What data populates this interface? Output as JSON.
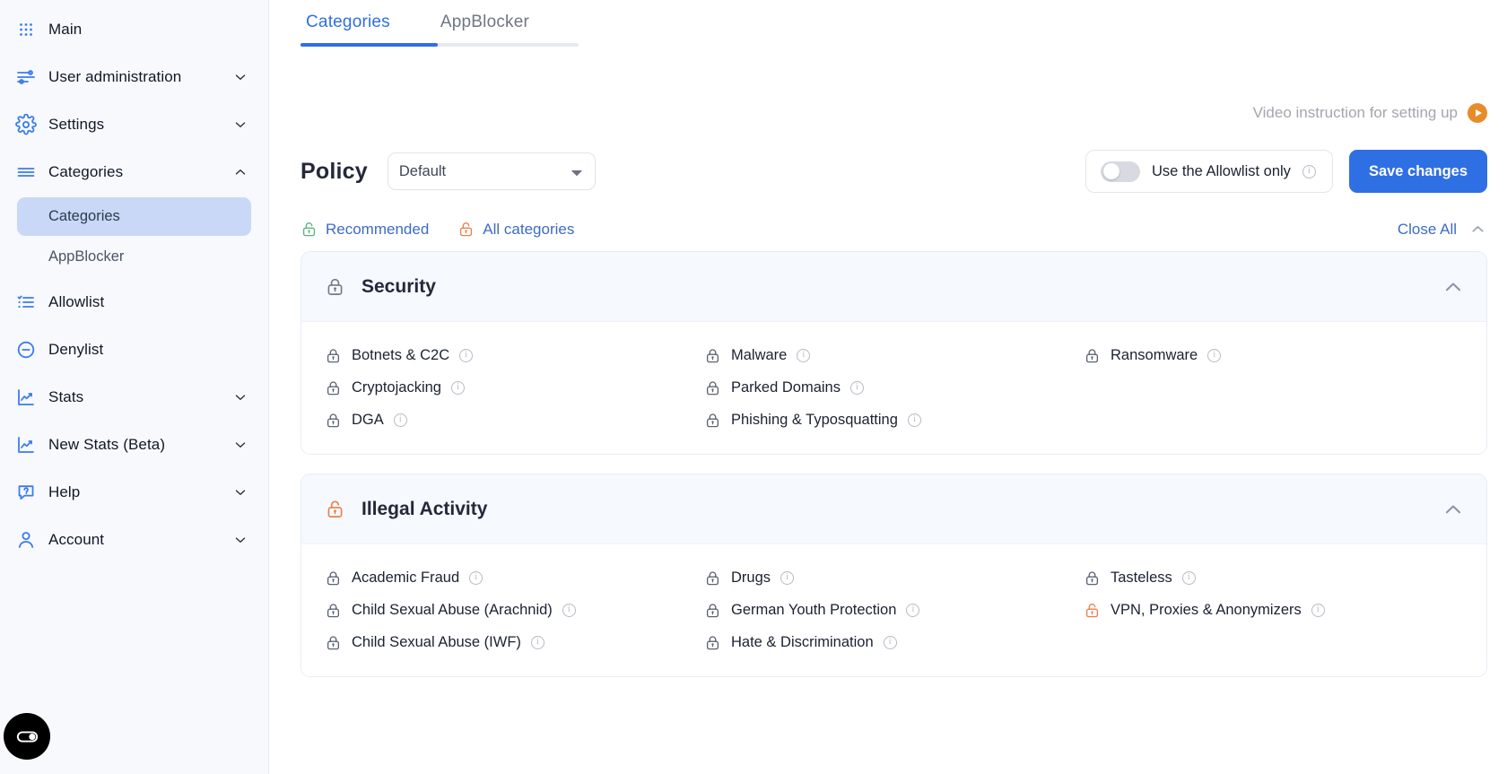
{
  "sidebar": {
    "items": [
      {
        "label": "Main",
        "icon": "grid-icon",
        "chevron": null
      },
      {
        "label": "User administration",
        "icon": "sliders-icon",
        "chevron": "down"
      },
      {
        "label": "Settings",
        "icon": "gear-icon",
        "chevron": "down"
      },
      {
        "label": "Categories",
        "icon": "menu-icon",
        "chevron": "up"
      }
    ],
    "sub_items": [
      {
        "label": "Categories",
        "active": true
      },
      {
        "label": "AppBlocker",
        "active": false
      }
    ],
    "items_bottom": [
      {
        "label": "Allowlist",
        "icon": "list-check-icon",
        "chevron": null
      },
      {
        "label": "Denylist",
        "icon": "minus-circle-icon",
        "chevron": null
      },
      {
        "label": "Stats",
        "icon": "chart-line-icon",
        "chevron": "down"
      },
      {
        "label": "New Stats (Beta)",
        "icon": "chart-line-icon",
        "chevron": "down"
      },
      {
        "label": "Help",
        "icon": "help-chat-icon",
        "chevron": "down"
      },
      {
        "label": "Account",
        "icon": "user-icon",
        "chevron": "down"
      }
    ],
    "cookie_button_icon": "cookie-consent-icon"
  },
  "tabs": [
    {
      "label": "Categories",
      "active": true
    },
    {
      "label": "AppBlocker",
      "active": false
    }
  ],
  "video": {
    "text": "Video instruction for setting up",
    "play_icon": "play-icon"
  },
  "policy": {
    "label": "Policy",
    "selected": "Default",
    "options": [
      "Default"
    ]
  },
  "allowlist_toggle": {
    "label": "Use the Allowlist only",
    "enabled": false,
    "info_icon": "info-icon"
  },
  "save": {
    "label": "Save changes"
  },
  "quick_links": [
    {
      "label": "Recommended",
      "icon": "unlock-icon",
      "color": "#5cb37e"
    },
    {
      "label": "All categories",
      "icon": "unlock-icon",
      "color": "#e8804a"
    }
  ],
  "close_all": {
    "label": "Close All",
    "icon": "chevron-up-icon"
  },
  "sections": [
    {
      "title": "Security",
      "lock_state": "locked",
      "lock_color": "#737a88",
      "expanded": true,
      "items": [
        {
          "label": "Botnets & C2C",
          "lock_state": "locked",
          "lock_color": "#5c6473"
        },
        {
          "label": "Cryptojacking",
          "lock_state": "locked",
          "lock_color": "#5c6473"
        },
        {
          "label": "DGA",
          "lock_state": "locked",
          "lock_color": "#5c6473"
        },
        {
          "label": "Malware",
          "lock_state": "locked",
          "lock_color": "#5c6473"
        },
        {
          "label": "Parked Domains",
          "lock_state": "locked",
          "lock_color": "#5c6473"
        },
        {
          "label": "Phishing & Typosquatting",
          "lock_state": "locked",
          "lock_color": "#5c6473"
        },
        {
          "label": "Ransomware",
          "lock_state": "locked",
          "lock_color": "#5c6473"
        },
        {
          "label": "",
          "lock_state": "none",
          "lock_color": ""
        },
        {
          "label": "",
          "lock_state": "none",
          "lock_color": ""
        }
      ]
    },
    {
      "title": "Illegal Activity",
      "lock_state": "unlocked",
      "lock_color": "#e8804a",
      "expanded": true,
      "items": [
        {
          "label": "Academic Fraud",
          "lock_state": "locked",
          "lock_color": "#5c6473"
        },
        {
          "label": "Child Sexual Abuse (Arachnid)",
          "lock_state": "locked",
          "lock_color": "#5c6473"
        },
        {
          "label": "Child Sexual Abuse (IWF)",
          "lock_state": "locked",
          "lock_color": "#5c6473"
        },
        {
          "label": "Drugs",
          "lock_state": "locked",
          "lock_color": "#5c6473"
        },
        {
          "label": "German Youth Protection",
          "lock_state": "locked",
          "lock_color": "#5c6473"
        },
        {
          "label": "Hate & Discrimination",
          "lock_state": "locked",
          "lock_color": "#5c6473"
        },
        {
          "label": "Tasteless",
          "lock_state": "locked",
          "lock_color": "#5c6473"
        },
        {
          "label": "VPN, Proxies & Anonymizers",
          "lock_state": "unlocked",
          "lock_color": "#e8804a"
        },
        {
          "label": "",
          "lock_state": "none",
          "lock_color": ""
        }
      ]
    }
  ],
  "colors": {
    "accent": "#2f6fe4",
    "link": "#3d6bc4",
    "orange": "#e8804a",
    "green": "#5cb37e",
    "sidebar_bg": "#f7f9fd",
    "active_sub_bg": "#c9d8f7"
  }
}
